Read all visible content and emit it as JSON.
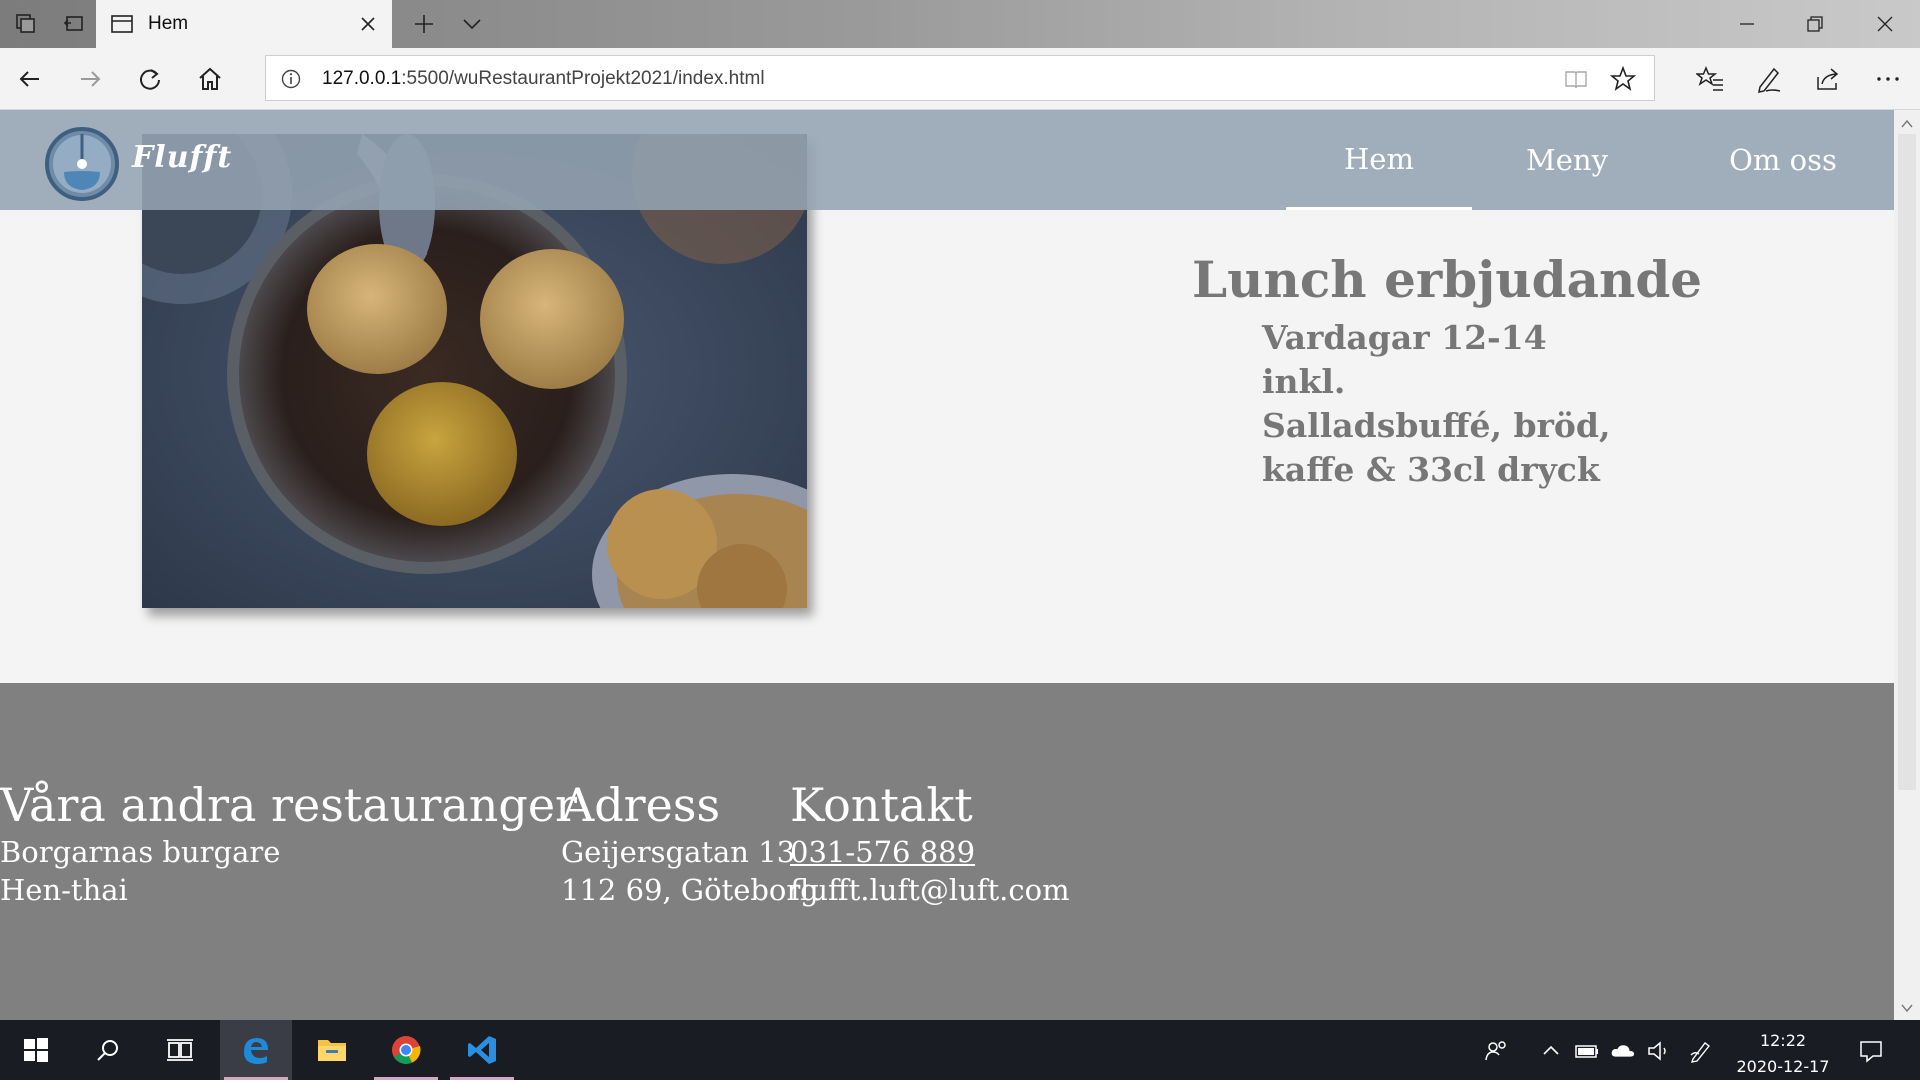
{
  "browser": {
    "tab_title": "Hem",
    "url_host": "127.0.0.1",
    "url_rest": ":5500/wuRestaurantProjekt2021/index.html"
  },
  "site": {
    "logo_text": "Flufft",
    "nav": [
      {
        "label": "Hem",
        "active": true
      },
      {
        "label": "Meny",
        "active": false
      },
      {
        "label": "Om oss",
        "active": false
      }
    ],
    "lunch": {
      "title": "Lunch erbjudande",
      "lines": [
        "Vardagar 12-14",
        "inkl.",
        "Salladsbuffé, bröd,",
        "kaffe & 33cl dryck"
      ]
    },
    "footer": {
      "restaurants": {
        "heading": "Våra andra restauranger",
        "items": [
          "Borgarnas burgare",
          "Hen-thai"
        ]
      },
      "address": {
        "heading": "Adress",
        "lines": [
          "Geijersgatan 13",
          "112 69, Göteborg"
        ]
      },
      "contact": {
        "heading": "Kontakt",
        "phone": "031-576 889",
        "email": "flufft.luft@luft.com"
      }
    }
  },
  "taskbar": {
    "time": "12:22",
    "date": "2020-12-17"
  },
  "colors": {
    "header": "#94a3b2",
    "footer": "#808080",
    "lunch_text": "#777777",
    "taskbar": "#1a1c24"
  }
}
